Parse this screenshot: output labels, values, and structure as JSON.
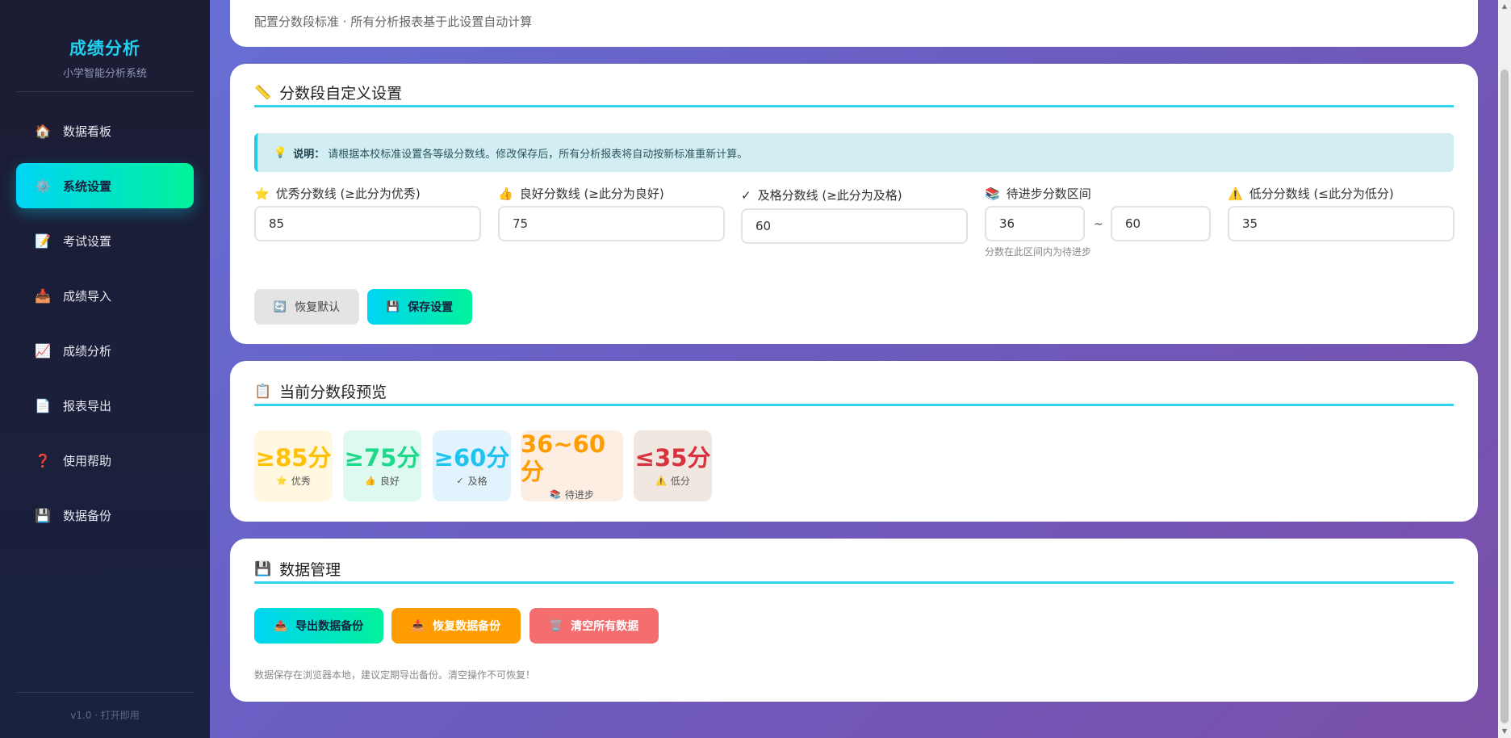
{
  "brand": {
    "title": "成绩分析",
    "subtitle": "小学智能分析系统"
  },
  "nav": [
    {
      "icon": "🏠",
      "label": "数据看板"
    },
    {
      "icon": "⚙️",
      "label": "系统设置"
    },
    {
      "icon": "📝",
      "label": "考试设置"
    },
    {
      "icon": "📥",
      "label": "成绩导入"
    },
    {
      "icon": "📈",
      "label": "成绩分析"
    },
    {
      "icon": "📄",
      "label": "报表导出"
    },
    {
      "icon": "❓",
      "label": "使用帮助"
    },
    {
      "icon": "💾",
      "label": "数据备份"
    }
  ],
  "active_nav": 1,
  "footer": {
    "version": "v1.0 · 打开即用"
  },
  "header": {
    "subtitle": "配置分数段标准 · 所有分析报表基于此设置自动计算"
  },
  "score_settings": {
    "icon": "📏",
    "title": "分数段自定义设置",
    "tip_icon": "💡",
    "tip_label": "说明：",
    "tip_text": "请根据本校标准设置各等级分数线。修改保存后，所有分析报表将自动按新标准重新计算。",
    "fields": {
      "excellent": {
        "icon": "⭐",
        "label": "优秀分数线 (≥此分为优秀)",
        "value": "85"
      },
      "good": {
        "icon": "👍",
        "label": "良好分数线 (≥此分为良好)",
        "value": "75"
      },
      "pass": {
        "icon": "✓",
        "label": "及格分数线 (≥此分为及格)",
        "value": "60"
      },
      "improve": {
        "icon": "📚",
        "label": "待进步分数区间",
        "min": "36",
        "max": "60",
        "tilde": "~",
        "hint": "分数在此区间内为待进步"
      },
      "low": {
        "icon": "⚠️",
        "label": "低分分数线 (≤此分为低分)",
        "value": "35"
      }
    },
    "reset_icon": "🔄",
    "reset_label": "恢复默认",
    "save_icon": "💾",
    "save_label": "保存设置"
  },
  "preview": {
    "icon": "📋",
    "title": "当前分数段预览",
    "items": [
      {
        "value": "≥85分",
        "icon": "⭐",
        "label": "优秀",
        "color": "#ffc107",
        "bg": "#fff7df"
      },
      {
        "value": "≥75分",
        "icon": "👍",
        "label": "良好",
        "color": "#1ed98a",
        "bg": "#ddf9f0"
      },
      {
        "value": "≥60分",
        "icon": "✓",
        "label": "及格",
        "color": "#1ec3f0",
        "bg": "#e2f3fd"
      },
      {
        "value": "36~60分",
        "icon": "📚",
        "label": "待进步",
        "color": "#ff9d00",
        "bg": "#fdeee3"
      },
      {
        "value": "≤35分",
        "icon": "⚠️",
        "label": "低分",
        "color": "#d8323f",
        "bg": "#efe7e0"
      }
    ]
  },
  "data_mgmt": {
    "icon": "💾",
    "title": "数据管理",
    "export_icon": "📤",
    "export_label": "导出数据备份",
    "restore_icon": "📥",
    "restore_label": "恢复数据备份",
    "clear_icon": "🗑️",
    "clear_label": "清空所有数据",
    "note": "数据保存在浏览器本地，建议定期导出备份。清空操作不可恢复！"
  }
}
